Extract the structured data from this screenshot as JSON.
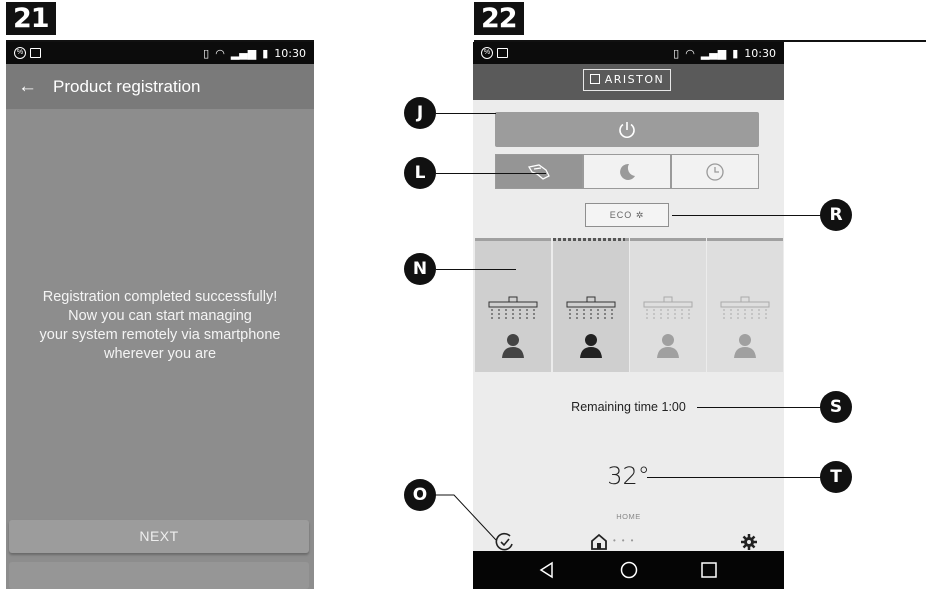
{
  "figures": {
    "left_number": "21",
    "right_number": "22"
  },
  "statusbar": {
    "time": "10:30"
  },
  "screen21": {
    "title": "Product registration",
    "message_lines": [
      "Registration completed successfully!",
      "Now you can start managing",
      "your system remotely via smartphone",
      "wherever you are"
    ],
    "next_label": "NEXT"
  },
  "screen22": {
    "brand": "ARISTON",
    "eco_label": "ECO",
    "remaining_time": "Remaining time 1:00",
    "temperature": "32°",
    "home_label": "HOME"
  },
  "callouts": {
    "J": "J",
    "L": "L",
    "R": "R",
    "N": "N",
    "S": "S",
    "T": "T",
    "O": "O"
  },
  "icons": [
    "power-icon",
    "hand-icon",
    "moon-icon",
    "clock-icon",
    "shower-icon",
    "person-icon",
    "check-circle-icon",
    "home-icon",
    "gear-icon",
    "back-arrow-icon",
    "nav-back-icon",
    "nav-home-icon",
    "nav-recent-icon"
  ]
}
